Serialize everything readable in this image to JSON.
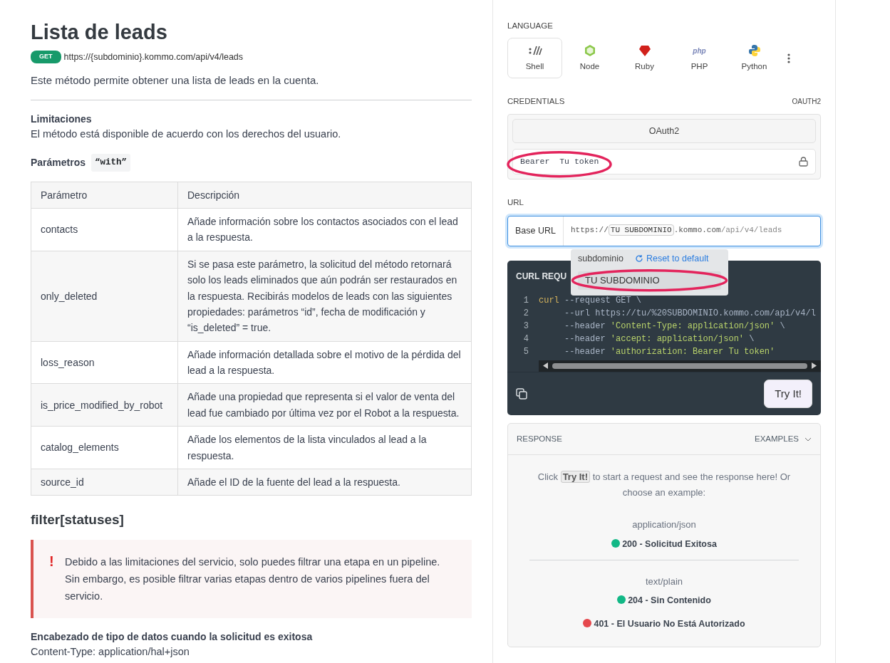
{
  "doc": {
    "title": "Lista de leads",
    "method": "GET",
    "endpoint": "https://{subdominio}.kommo.com/api/v4/leads",
    "description": "Este método permite obtener una lista de leads en la cuenta.",
    "limits_title": "Limitaciones",
    "limits_text": "El método está disponible de acuerdo con los derechos del usuario.",
    "params_title": "Parámetros",
    "params_code": "“with”",
    "table": {
      "columns": [
        "Parámetro",
        "Descripción"
      ],
      "rows": [
        {
          "param": "contacts",
          "description": "Añade información sobre los contactos asociados con el lead a la respuesta."
        },
        {
          "param": "only_deleted",
          "description": "Si se pasa este parámetro, la solicitud del método retornará solo los leads eliminados que aún podrán ser restaurados en la respuesta. Recibirás modelos de leads con las siguientes propiedades: parámetros “id”, fecha de modificación y “is_deleted” = true."
        },
        {
          "param": "loss_reason",
          "description": "Añade información detallada sobre el motivo de la pérdida del lead a la respuesta."
        },
        {
          "param": "is_price_modified_by_robot",
          "description": "Añade una propiedad que representa si el valor de venta del lead fue cambiado por última vez por el Robot a la respuesta."
        },
        {
          "param": "catalog_elements",
          "description": "Añade los elementos de la lista vinculados al lead a la respuesta."
        },
        {
          "param": "source_id",
          "description": "Añade el ID de la fuente del lead a la respuesta."
        }
      ]
    },
    "filter_title": "filter[statuses]",
    "alert": {
      "icon": "!",
      "text": "Debido a las limitaciones del servicio, solo puedes filtrar una etapa en un pipeline. Sin embargo, es posible filtrar varias etapas dentro de varios pipelines fuera del servicio."
    },
    "header_title": "Encabezado de tipo de datos cuando la solicitud es exitosa",
    "header_text": "Content-Type: application/hal+json"
  },
  "panel": {
    "language_label": "LANGUAGE",
    "languages": [
      {
        "name": "Shell",
        "kind": "shell",
        "selected": true
      },
      {
        "name": "Node",
        "kind": "node",
        "selected": false
      },
      {
        "name": "Ruby",
        "kind": "ruby",
        "selected": false
      },
      {
        "name": "PHP",
        "kind": "php",
        "selected": false,
        "logo_text": "php"
      },
      {
        "name": "Python",
        "kind": "python",
        "selected": false
      }
    ],
    "credentials_label": "CREDENTIALS",
    "credentials_type": "OAUTH2",
    "auth_button": "OAuth2",
    "token_prefix": "Bearer",
    "token_value": "Tu token",
    "url_label": "URL",
    "base_url_label": "Base URL",
    "url_start": "https://",
    "url_var": "TU SUBDOMINIO",
    "url_host": ".kommo.com",
    "url_path": "/api/v4/leads",
    "popover": {
      "var_name": "subdominio",
      "reset": "Reset to default",
      "value": "TU SUBDOMINIO"
    },
    "code": {
      "title": "CURL REQU",
      "lines": [
        {
          "number": "1",
          "tokens": [
            {
              "text": "curl",
              "kind": "cmd"
            },
            {
              "text": " --request GET \\",
              "kind": "flag"
            }
          ]
        },
        {
          "number": "2",
          "tokens": [
            {
              "text": "     --url https://tu/%20SUBDOMINIO.kommo.com/api/v4/l",
              "kind": "flag"
            }
          ]
        },
        {
          "number": "3",
          "tokens": [
            {
              "text": "     --header ",
              "kind": "flag"
            },
            {
              "text": "'Content-Type: application/json'",
              "kind": "string"
            },
            {
              "text": " \\",
              "kind": "flag"
            }
          ]
        },
        {
          "number": "4",
          "tokens": [
            {
              "text": "     --header ",
              "kind": "flag"
            },
            {
              "text": "'accept: application/json'",
              "kind": "string"
            },
            {
              "text": " \\",
              "kind": "flag"
            }
          ]
        },
        {
          "number": "5",
          "tokens": [
            {
              "text": "     --header ",
              "kind": "flag"
            },
            {
              "text": "'authorization: Bearer Tu token'",
              "kind": "string"
            }
          ]
        }
      ],
      "try_button": "Try It!"
    },
    "response": {
      "label": "RESPONSE",
      "examples": "EXAMPLES",
      "hint_before": "Click",
      "hint_button": "Try It!",
      "hint_after": "to start a request and see the response here! Or choose an example:",
      "groups": [
        {
          "type": "application/json",
          "items": [
            {
              "label": "200 - Solicitud Exitosa",
              "color": "#12b886"
            }
          ]
        },
        {
          "type": "text/plain",
          "items": [
            {
              "label": "204 - Sin Contenido",
              "color": "#12b886"
            },
            {
              "label": "401 - El Usuario No Está Autorizado",
              "color": "#e5484d"
            }
          ]
        }
      ]
    }
  },
  "annotations": [
    {
      "kind": "ellipse"
    },
    {
      "kind": "ellipse"
    }
  ]
}
